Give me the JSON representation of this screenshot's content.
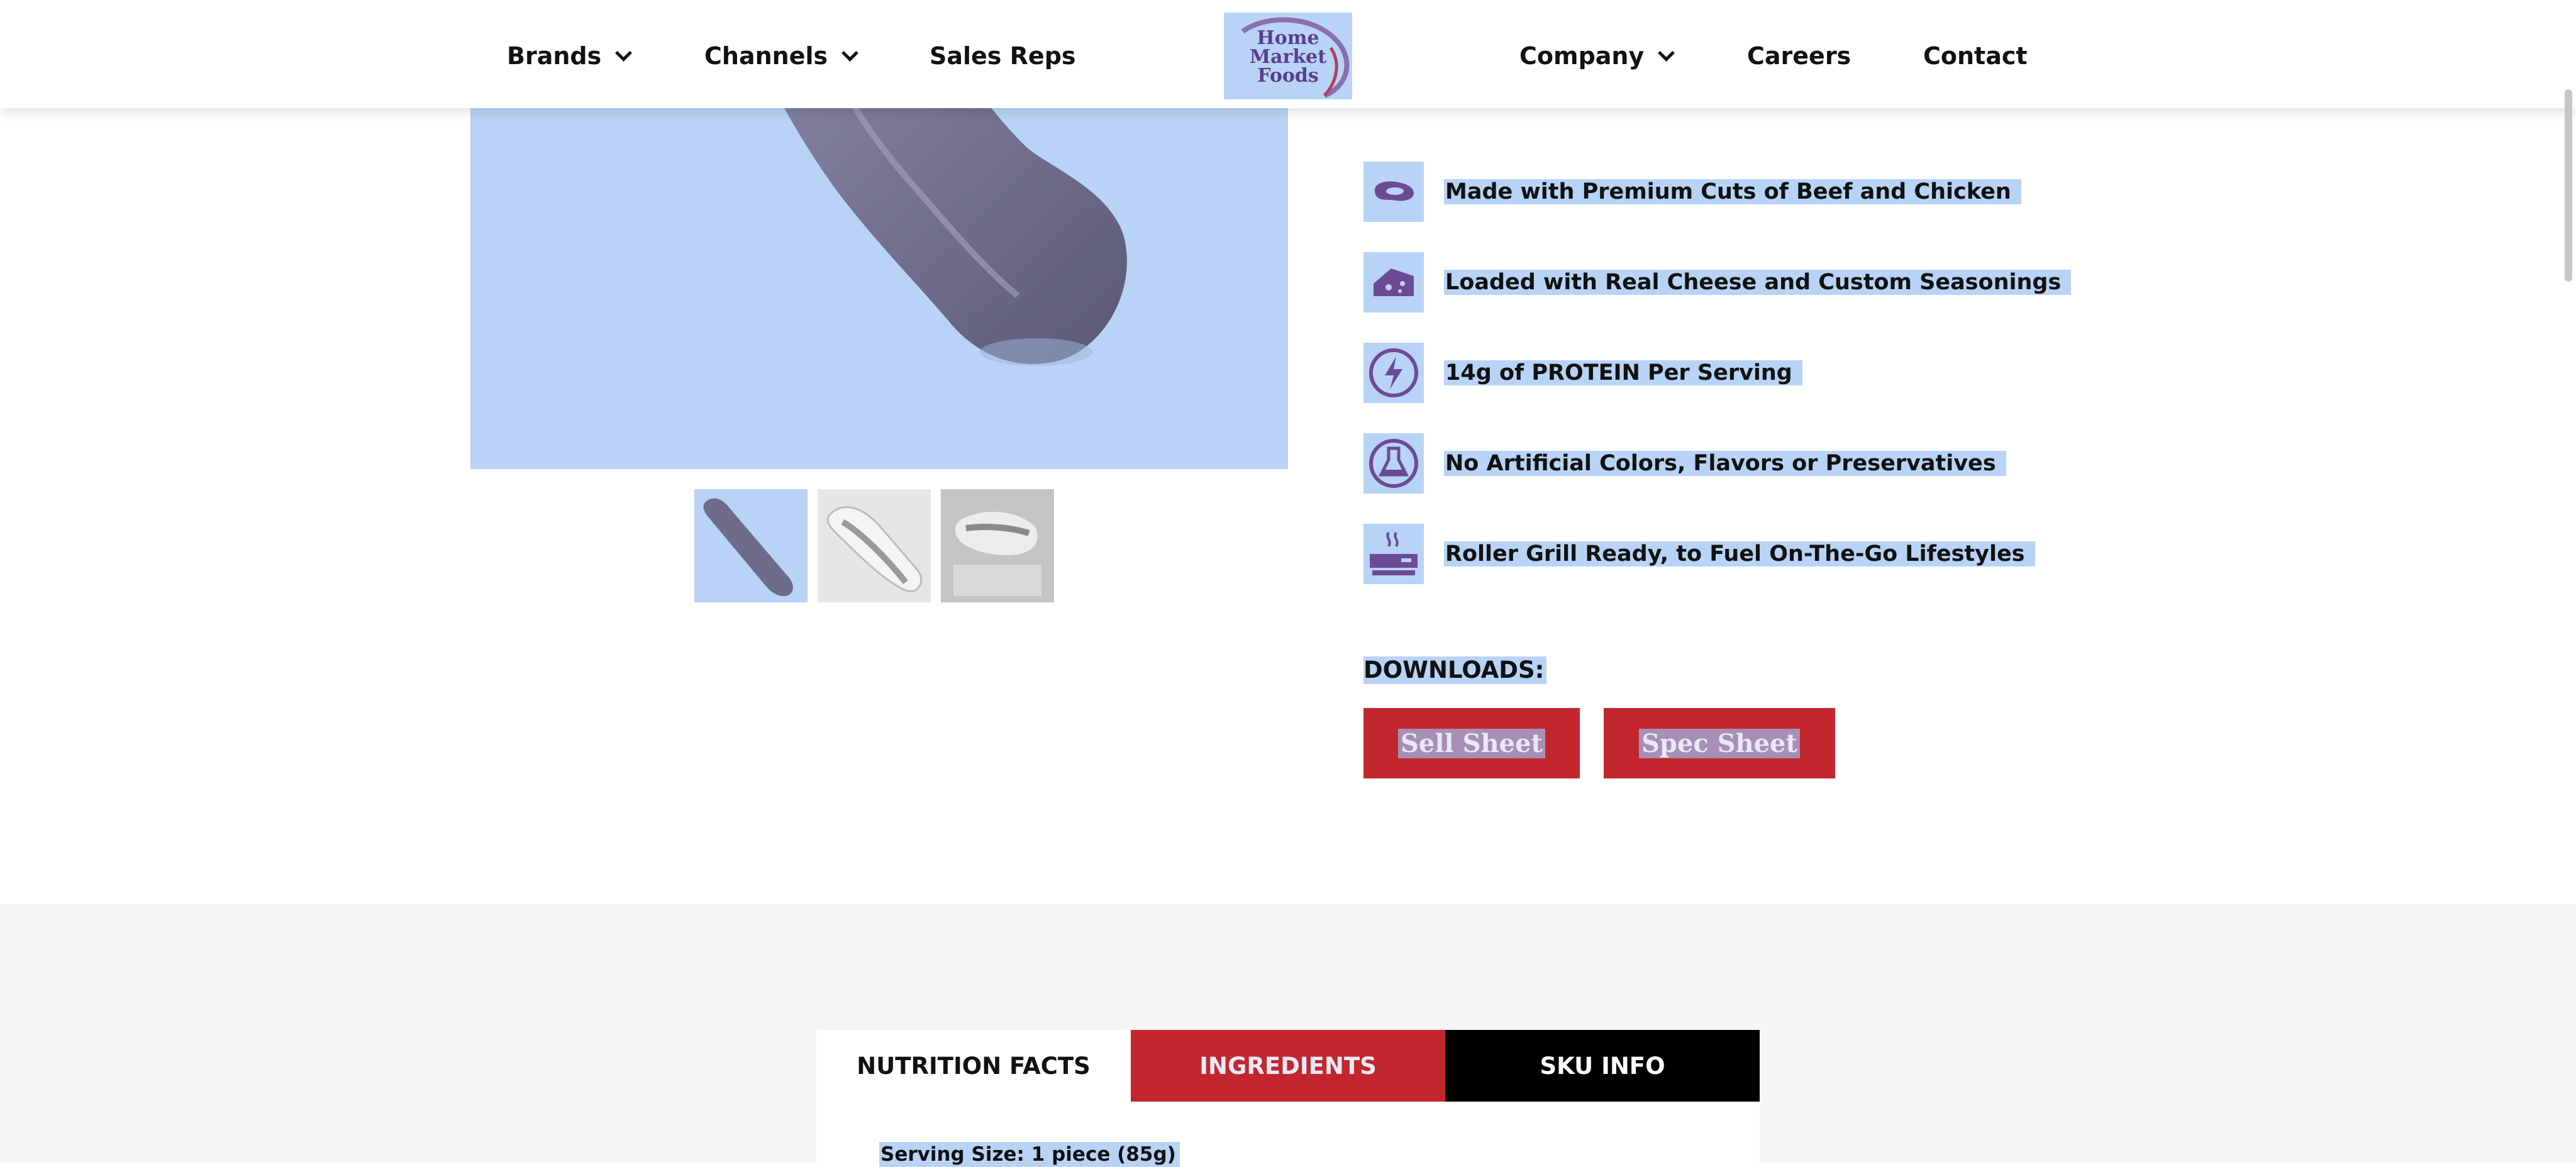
{
  "header": {
    "nav_left": [
      {
        "label": "Brands",
        "has_dropdown": true
      },
      {
        "label": "Channels",
        "has_dropdown": true
      },
      {
        "label": "Sales Reps",
        "has_dropdown": false
      }
    ],
    "logo": {
      "line1": "Home",
      "line2": "Market",
      "line3": "Foods"
    },
    "nav_right": [
      {
        "label": "Company",
        "has_dropdown": true
      },
      {
        "label": "Careers",
        "has_dropdown": false
      },
      {
        "label": "Contact",
        "has_dropdown": false
      }
    ]
  },
  "product": {
    "image_icon": "sausage-image",
    "thumbnails": [
      "sausage-thumbnail",
      "hot-dog-bun-thumbnail",
      "hot-dog-serving-thumbnail"
    ]
  },
  "features": [
    {
      "icon": "steak-icon",
      "text": "Made with Premium Cuts of Beef and Chicken"
    },
    {
      "icon": "cheese-icon",
      "text": "Loaded with Real Cheese and Custom Seasonings"
    },
    {
      "icon": "lightning-icon",
      "text": "14g of PROTEIN Per Serving"
    },
    {
      "icon": "flask-icon",
      "text": "No Artificial Colors, Flavors or Preservatives"
    },
    {
      "icon": "roller-grill-icon",
      "text": "Roller Grill Ready, to Fuel On-The-Go Lifestyles"
    }
  ],
  "downloads": {
    "heading": "DOWNLOADS:",
    "buttons": [
      "Sell Sheet",
      "Spec Sheet"
    ]
  },
  "tabs": {
    "items": [
      "NUTRITION FACTS",
      "INGREDIENTS",
      "SKU INFO"
    ],
    "active": "NUTRITION FACTS"
  },
  "nutrition": {
    "serving_size": "Serving Size: 1 piece (85g)"
  },
  "colors": {
    "accent_red": "#c1272d",
    "selection_blue": "#b8d3f5",
    "icon_purple": "#5a3e8e"
  }
}
